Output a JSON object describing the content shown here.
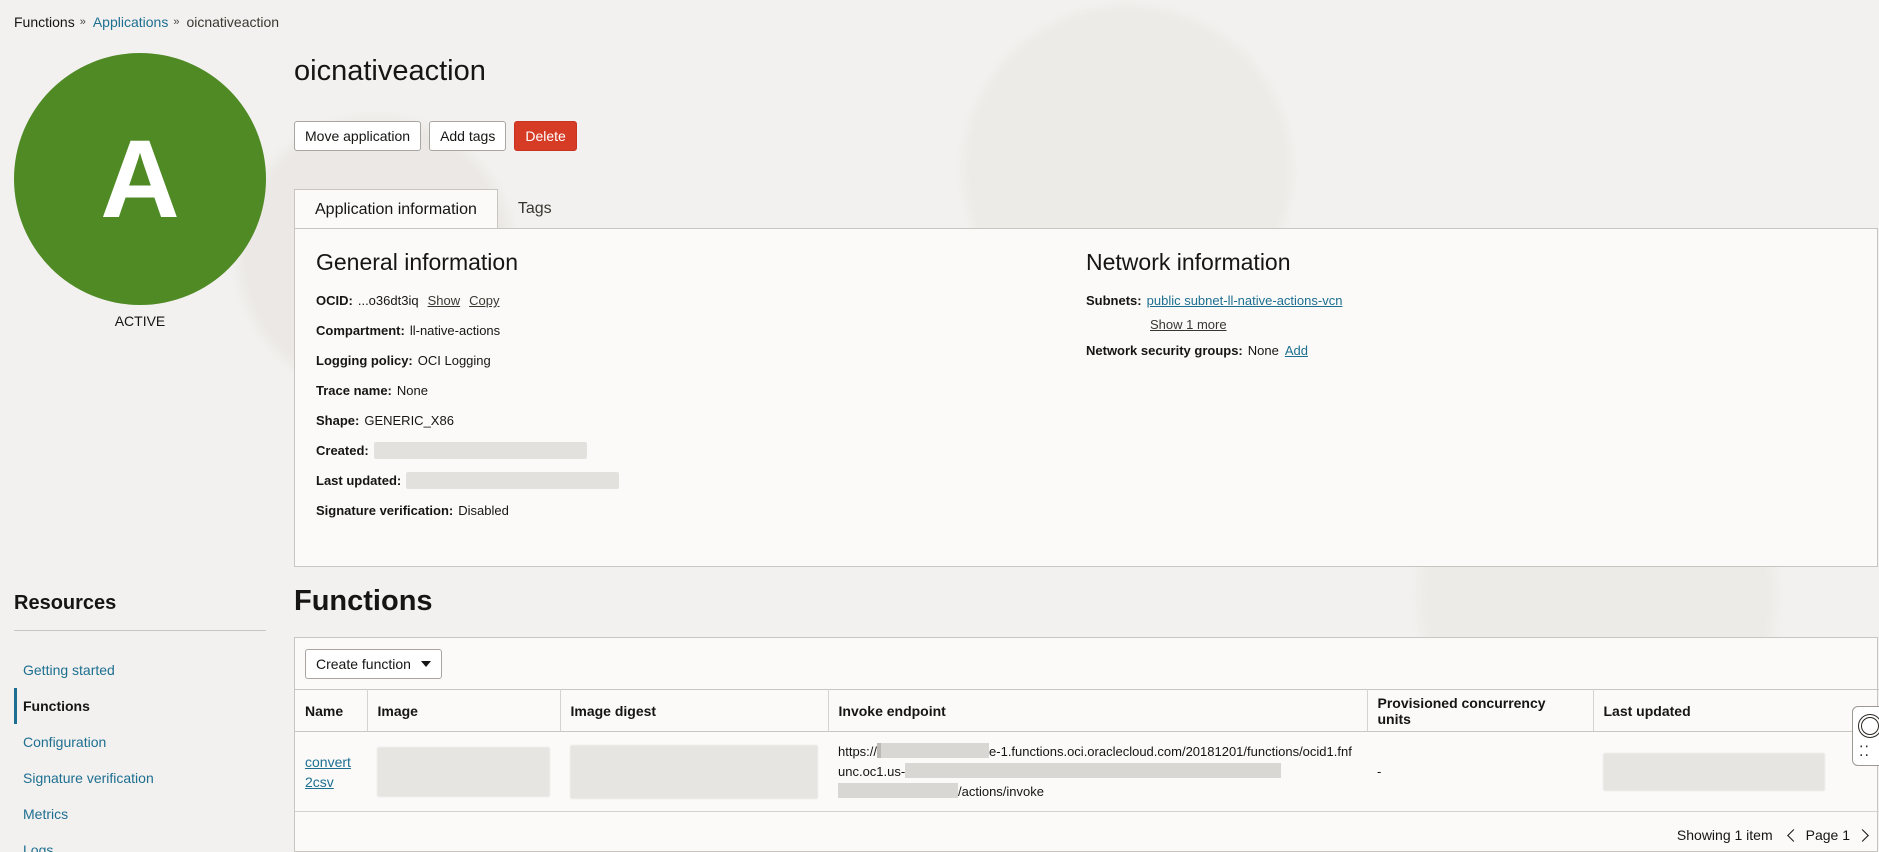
{
  "breadcrumb": {
    "items": [
      {
        "label": "Functions"
      },
      {
        "label": "Applications"
      },
      {
        "label": "oicnativeaction"
      }
    ],
    "separator": "»"
  },
  "avatar": {
    "letter": "A",
    "color": "#4f8a25"
  },
  "status": "ACTIVE",
  "app": {
    "title": "oicnativeaction"
  },
  "actions": {
    "move": "Move application",
    "add_tags": "Add tags",
    "delete": "Delete"
  },
  "tabs": [
    {
      "label": "Application information",
      "active": true
    },
    {
      "label": "Tags",
      "active": false
    }
  ],
  "general": {
    "heading": "General information",
    "ocid_label": "OCID:",
    "ocid_value": "...o36dt3iq",
    "ocid_show": "Show",
    "ocid_copy": "Copy",
    "compartment_label": "Compartment:",
    "compartment_value": "ll-native-actions",
    "logging_label": "Logging policy:",
    "logging_value": "OCI Logging",
    "trace_label": "Trace name:",
    "trace_value": "None",
    "shape_label": "Shape:",
    "shape_value": "GENERIC_X86",
    "created_label": "Created:",
    "updated_label": "Last updated:",
    "signature_label": "Signature verification:",
    "signature_value": "Disabled"
  },
  "network": {
    "heading": "Network information",
    "subnets_label": "Subnets:",
    "subnet_link": "public subnet-ll-native-actions-vcn",
    "show_more": "Show 1 more",
    "nsg_label": "Network security groups:",
    "nsg_value": "None",
    "nsg_add": "Add"
  },
  "resources": {
    "heading": "Resources",
    "items": [
      {
        "label": "Getting started",
        "active": false
      },
      {
        "label": "Functions",
        "active": true
      },
      {
        "label": "Configuration",
        "active": false
      },
      {
        "label": "Signature verification",
        "active": false
      },
      {
        "label": "Metrics",
        "active": false
      },
      {
        "label": "Logs",
        "active": false
      }
    ]
  },
  "functions": {
    "heading": "Functions",
    "create_button": "Create function",
    "columns": [
      "Name",
      "Image",
      "Image digest",
      "Invoke endpoint",
      "Provisioned concurrency units",
      "Last updated"
    ],
    "rows": [
      {
        "name_line1": "convert",
        "name_line2": "2csv",
        "endpoint_part1": "https://",
        "endpoint_part2": "e-1.functions.oci.oraclecloud.com/20181201/function",
        "endpoint_part3": "s/ocid1.fnfunc.oc1.us-",
        "endpoint_part4": "/actions/invoke",
        "provisioned": "-"
      }
    ],
    "showing": "Showing 1 item",
    "page": "Page 1"
  }
}
